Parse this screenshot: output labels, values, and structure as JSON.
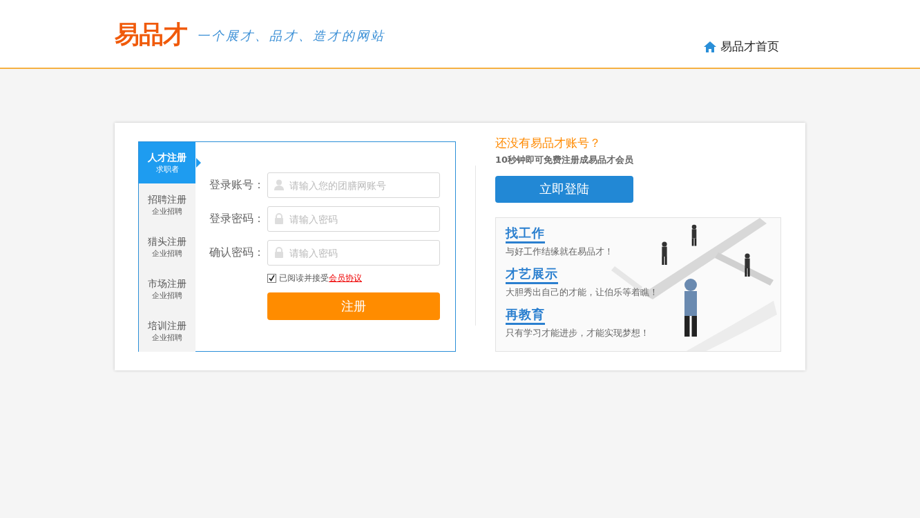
{
  "header": {
    "logo": "易品才",
    "slogan": "一个展才、品才、造才的网站",
    "home_link": "易品才首页"
  },
  "tabs": [
    {
      "title": "人才注册",
      "subtitle": "求职者",
      "selected": true
    },
    {
      "title": "招聘注册",
      "subtitle": "企业招聘",
      "selected": false
    },
    {
      "title": "猎头注册",
      "subtitle": "企业招聘",
      "selected": false
    },
    {
      "title": "市场注册",
      "subtitle": "企业招聘",
      "selected": false
    },
    {
      "title": "培训注册",
      "subtitle": "企业招聘",
      "selected": false
    }
  ],
  "form": {
    "fields": [
      {
        "label": "登录账号：",
        "placeholder": "请输入您的团膳网账号",
        "kind": "user"
      },
      {
        "label": "登录密码：",
        "placeholder": "请输入密码",
        "kind": "password"
      },
      {
        "label": "确认密码：",
        "placeholder": "请输入密码",
        "kind": "password"
      }
    ],
    "agreement": {
      "checked": true,
      "text": "已阅读并接受",
      "link": "会员协议"
    },
    "submit": "注册"
  },
  "side": {
    "title": "还没有易品才账号？",
    "subtitle": "10秒钟即可免费注册成易品才会员",
    "button": "立即登陆",
    "banner": [
      {
        "heading": "找工作",
        "text": "与好工作结缘就在易品才！"
      },
      {
        "heading": "才艺展示",
        "text": "大胆秀出自己的才能，让伯乐等着瞧！"
      },
      {
        "heading": "再教育",
        "text": "只有学习才能进步，才能实现梦想！"
      }
    ]
  }
}
